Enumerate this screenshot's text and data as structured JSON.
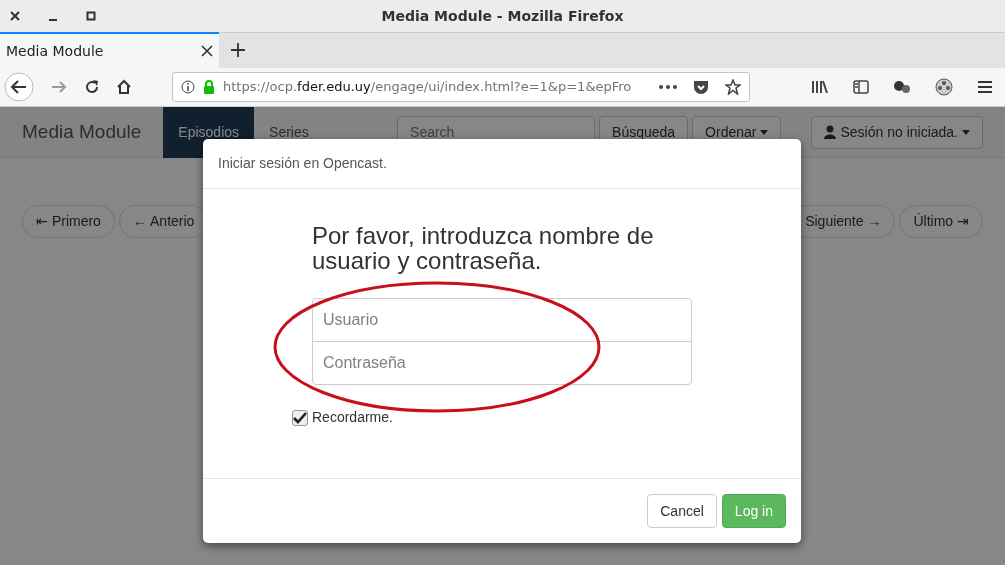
{
  "window": {
    "title": "Media Module - Mozilla Firefox"
  },
  "browser": {
    "tabs": [
      {
        "label": "Media Module",
        "selected": true
      }
    ],
    "url": {
      "prefix": "https://ocp.",
      "host": "fder.edu.uy",
      "path": "/engage/ui/index.html?e=1&p=1&epFro"
    }
  },
  "app": {
    "brand": "Media Module",
    "nav": [
      {
        "label": "Episodios",
        "selected": true
      },
      {
        "label": "Series",
        "selected": false
      }
    ],
    "search": {
      "placeholder": "Search"
    },
    "search_button": "Búsqueda",
    "sort_button": "Ordenar",
    "user_button": "Sesión no iniciada.",
    "pager_left": [
      "⇤ Primero",
      "← Anterio"
    ],
    "pager_right": [
      "Siguiente →",
      "Último ⇥"
    ]
  },
  "modal": {
    "title": "Iniciar sesión en Opencast.",
    "heading": "Por favor, introduzca nombre de usuario y contraseña.",
    "fields": [
      {
        "placeholder": "Usuario"
      },
      {
        "placeholder": "Contraseña"
      }
    ],
    "remember": {
      "label": "Recordarme.",
      "checked": true
    },
    "buttons": [
      {
        "label": "Cancel",
        "kind": "default"
      },
      {
        "label": "Log in",
        "kind": "primary"
      }
    ]
  }
}
